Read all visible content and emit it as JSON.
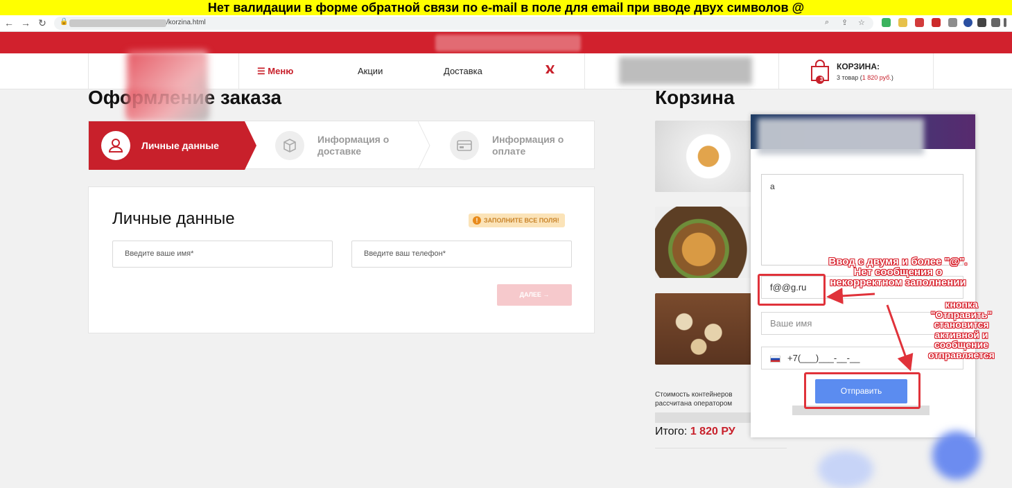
{
  "banner": {
    "text": "Нет валидации в форме обратной связи по e-mail в поле для email при вводе двух символов @"
  },
  "browser": {
    "url_path": "/korzina.html"
  },
  "header": {
    "menu": "Меню",
    "promo": "Акции",
    "delivery": "Доставка",
    "vk": "vk",
    "cart_title": "КОРЗИНА:",
    "cart_count": "3",
    "cart_summary_prefix": "3 товар (",
    "cart_summary_price": "1 820 руб.",
    "cart_summary_suffix": ")"
  },
  "page": {
    "title": "Оформление заказа",
    "cart_heading": "Корзина"
  },
  "steps": [
    {
      "label_line1": "Личные данные",
      "label_line2": ""
    },
    {
      "label_line1": "Информация о",
      "label_line2": "доставке"
    },
    {
      "label_line1": "Информация о",
      "label_line2": "оплате"
    }
  ],
  "form": {
    "title": "Личные данные",
    "badge": "ЗАПОЛНИТЕ ВСЕ ПОЛЯ!",
    "name_placeholder": "Введите ваше имя*",
    "phone_placeholder": "Введите ваш телефон*",
    "next_button": "ДАЛЕЕ →"
  },
  "cart_side": {
    "cost_line1": "Стоимость контейнеров",
    "cost_line2": "рассчитана оператором",
    "total_label": "Итого:",
    "total_value": "1 820 РУ"
  },
  "popup": {
    "message_value": "a",
    "email_value": "f@@g.ru",
    "name_placeholder": "Ваше имя",
    "phone_value": "+7(___)___-__-__",
    "send_button": "Отправить"
  },
  "annotations": {
    "email_note": "Ввод с двумя и более \"@\". Нет сообщения о некорректном заполнении",
    "button_note": "кнопка \"Отправить\" становится активной и сообщение отправляется"
  },
  "colors": {
    "brand_red": "#c8202b",
    "send_blue": "#5b8cf0",
    "annotation_red": "#e0323a",
    "banner_yellow": "#ffff00"
  }
}
